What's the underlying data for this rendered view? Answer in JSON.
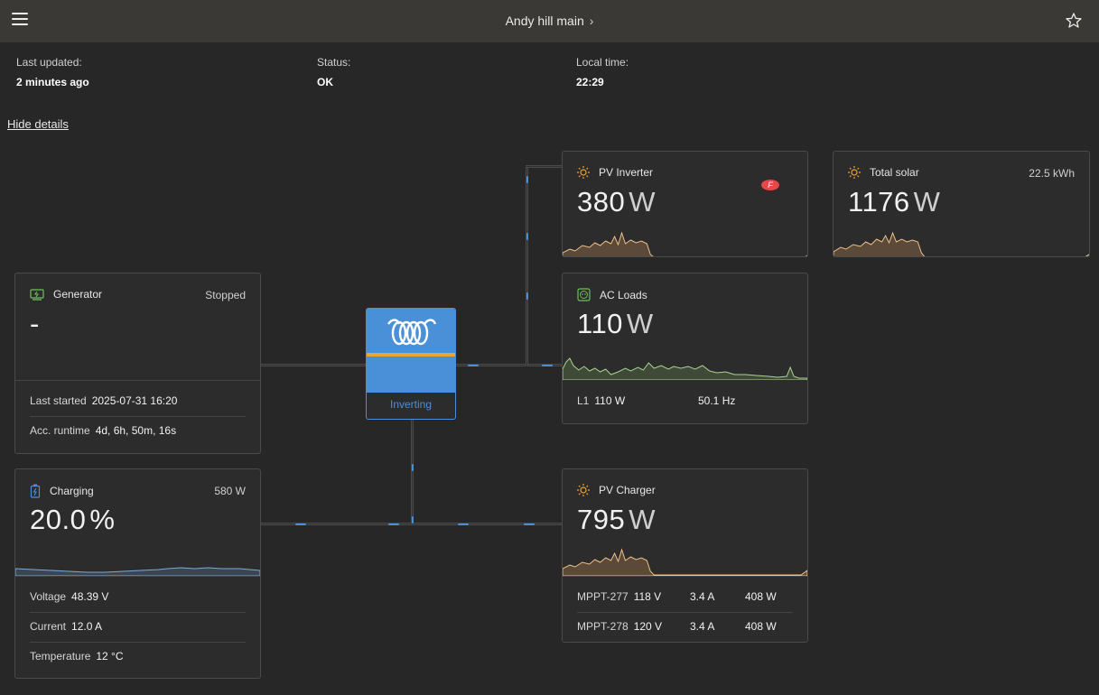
{
  "header": {
    "title": "Andy hill main"
  },
  "info": {
    "last_updated_label": "Last updated:",
    "last_updated_value": "2 minutes ago",
    "status_label": "Status:",
    "status_value": "OK",
    "local_time_label": "Local time:",
    "local_time_value": "22:29"
  },
  "hide_details": "Hide details",
  "pv_inverter": {
    "title": "PV Inverter",
    "value": "380",
    "unit": "W",
    "icon": "sun-icon",
    "badge_icon": "fronius-logo-icon"
  },
  "total_solar": {
    "title": "Total solar",
    "aside": "22.5 kWh",
    "value": "1176",
    "unit": "W",
    "icon": "sun-icon"
  },
  "generator": {
    "title": "Generator",
    "aside": "Stopped",
    "value": "-",
    "icon": "generator-icon",
    "rows": [
      {
        "label": "Last started",
        "value": "2025-07-31 16:20"
      },
      {
        "label": "Acc. runtime",
        "value": "4d, 6h, 50m, 16s"
      }
    ]
  },
  "inverter": {
    "state": "Inverting",
    "icon": "victron-logo-icon"
  },
  "ac_loads": {
    "title": "AC Loads",
    "value": "110",
    "unit": "W",
    "icon": "socket-icon",
    "row": {
      "phase": "L1",
      "power": "110 W",
      "freq": "50.1 Hz"
    }
  },
  "battery": {
    "title": "Charging",
    "aside": "580 W",
    "value": "20.0",
    "unit": "%",
    "icon": "battery-charging-icon",
    "rows": [
      {
        "label": "Voltage",
        "value": "48.39 V"
      },
      {
        "label": "Current",
        "value": "12.0 A"
      },
      {
        "label": "Temperature",
        "value": "12 °C"
      }
    ]
  },
  "pv_charger": {
    "title": "PV Charger",
    "value": "795",
    "unit": "W",
    "icon": "sun-icon",
    "rows": [
      {
        "name": "MPPT-277",
        "voltage": "118 V",
        "current": "3.4 A",
        "power": "408 W"
      },
      {
        "name": "MPPT-278",
        "voltage": "120 V",
        "current": "3.4 A",
        "power": "408 W"
      }
    ]
  },
  "colors": {
    "solar": "#f0a430",
    "battery": "#4a90d9",
    "loads": "#6fbf5a",
    "background": "#272727"
  }
}
